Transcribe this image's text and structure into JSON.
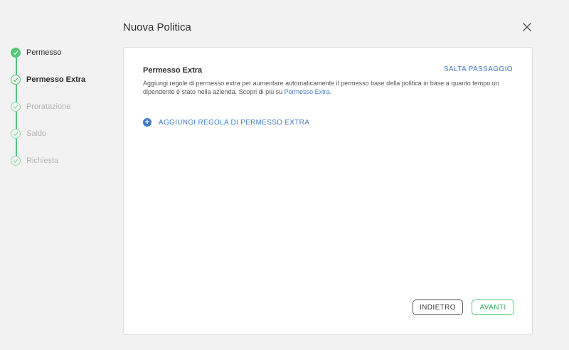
{
  "header": {
    "title": "Nuova Politica"
  },
  "steps": [
    {
      "label": "Permesso",
      "state": "done"
    },
    {
      "label": "Permesso Extra",
      "state": "current"
    },
    {
      "label": "Proratazione",
      "state": "todo"
    },
    {
      "label": "Saldo",
      "state": "todo"
    },
    {
      "label": "Richiesta",
      "state": "todo"
    }
  ],
  "card": {
    "title": "Permesso Extra",
    "skip_label": "SALTA PASSAGGIO",
    "description": "Aggiungi regole di permesso extra per aumentare automaticamente il permesso base della politica in base a quanto tempo un dipendente è stato nella azienda. Scopri di più su ",
    "description_link": "Permesso Extra",
    "description_end": ".",
    "add_rule_label": "AGGIUNGI REGOLA DI PERMESSO EXTRA"
  },
  "footer": {
    "back_label": "INDIETRO",
    "next_label": "AVANTI"
  },
  "colors": {
    "accent_green": "#54c878",
    "link_blue": "#3f7bc6",
    "background": "#f2f2f2"
  }
}
